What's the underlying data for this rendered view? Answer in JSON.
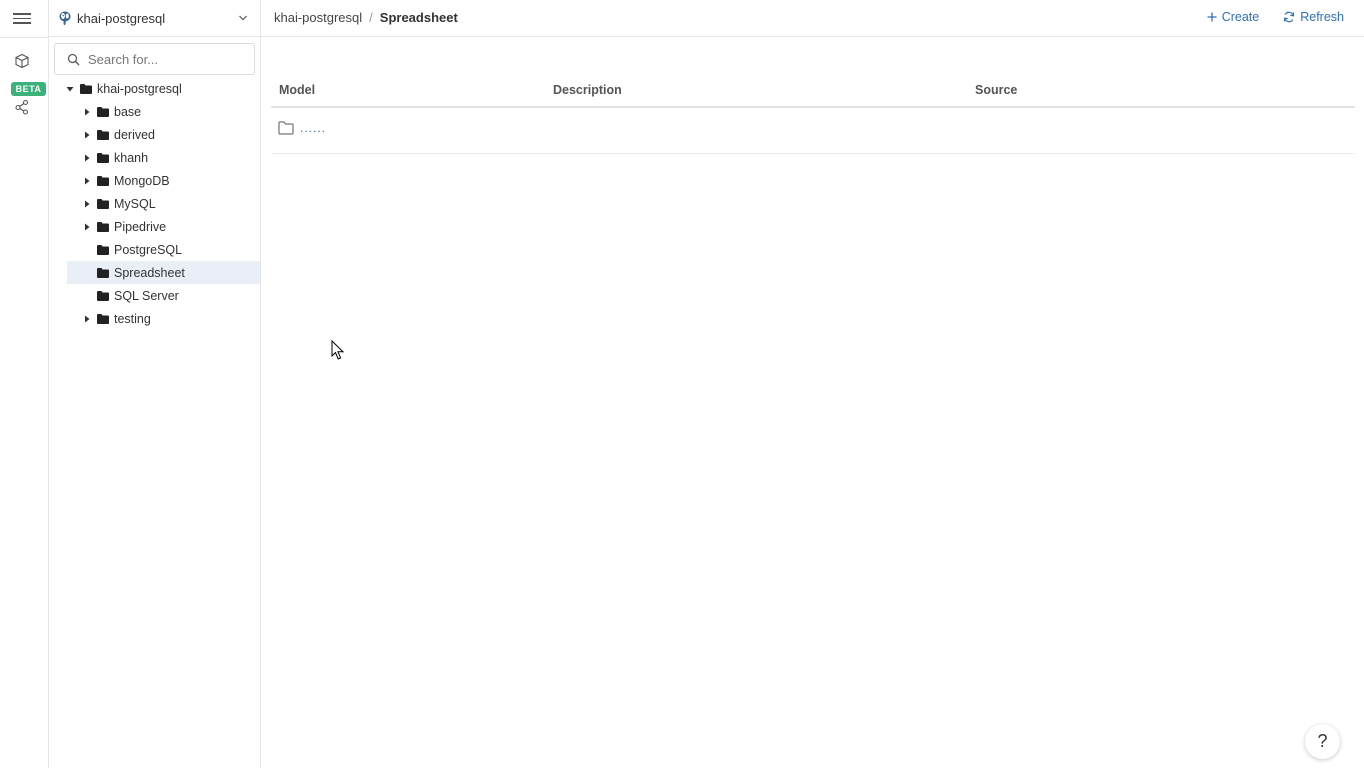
{
  "rail": {
    "menu_icon": "hamburger-menu-icon",
    "items": [
      {
        "icon": "cube-icon",
        "name": "models"
      },
      {
        "icon": "share-nodes-icon",
        "name": "lineage",
        "badge": "BETA"
      }
    ]
  },
  "sidebar": {
    "datasource": {
      "name": "khai-postgresql",
      "icon": "postgresql-elephant-icon"
    },
    "search": {
      "placeholder": "Search for..."
    },
    "tree": {
      "root": {
        "label": "khai-postgresql",
        "expanded": true
      },
      "children": [
        {
          "label": "base",
          "expandable": true
        },
        {
          "label": "derived",
          "expandable": true
        },
        {
          "label": "khanh",
          "expandable": true
        },
        {
          "label": "MongoDB",
          "expandable": true
        },
        {
          "label": "MySQL",
          "expandable": true
        },
        {
          "label": "Pipedrive",
          "expandable": true
        },
        {
          "label": "PostgreSQL",
          "expandable": false
        },
        {
          "label": "Spreadsheet",
          "expandable": false,
          "selected": true
        },
        {
          "label": "SQL Server",
          "expandable": false
        },
        {
          "label": "testing",
          "expandable": true
        }
      ]
    }
  },
  "header": {
    "breadcrumb": {
      "parent": "khai-postgresql",
      "separator": "/",
      "current": "Spreadsheet"
    },
    "actions": {
      "create": "Create",
      "refresh": "Refresh"
    }
  },
  "table": {
    "columns": [
      "Model",
      "Description",
      "Source"
    ],
    "rows": [
      {
        "name": "......",
        "icon": "folder-outline-icon"
      }
    ]
  },
  "help": {
    "label": "?"
  },
  "colors": {
    "accent": "#2f6fbf",
    "beta": "#3bb27a",
    "selected_bg": "#e9eef7"
  }
}
